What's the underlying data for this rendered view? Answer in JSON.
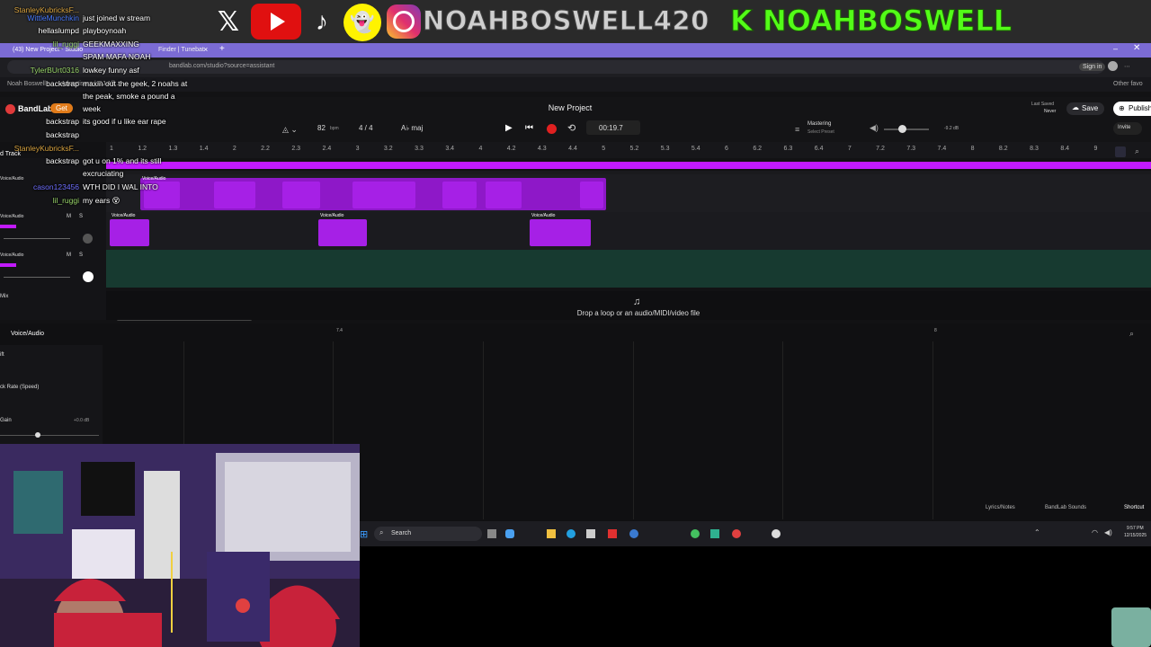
{
  "overlay": {
    "instagram_handle": "NOAHBOSWELL420",
    "kick_handle": "K NOAHBOSWELL",
    "x_icon_glyph": "𝕏",
    "tiktok_icon_glyph": "♪",
    "snapchat_icon_glyph": "👻",
    "youtube_color": "#e01010",
    "kick_color": "#53fc18"
  },
  "chat": [
    {
      "user": "StanleyKubricksF...",
      "message": "",
      "color": "#d9a441"
    },
    {
      "user": "WittleMunchkin",
      "message": "just joined w stream",
      "color": "#4a7cff"
    },
    {
      "user": "hellaslumpd",
      "message": "playboynoah",
      "color": "#ffffff"
    },
    {
      "user": "lil_ruggi",
      "message": "GEEKMAXXING",
      "color": "#9ad66b"
    },
    {
      "user": "",
      "message": "SPAM MAFA NOAH",
      "color": "#ffffff"
    },
    {
      "user": "TylerBUrt0316",
      "message": "lowkey funny asf",
      "color": "#9ad66b"
    },
    {
      "user": "backstrap",
      "message": "maxin out the geek, 2 noahs at",
      "color": "#ffffff"
    },
    {
      "user": "",
      "message": "the peak, smoke a pound a",
      "color": "#ffffff"
    },
    {
      "user": "",
      "message": "week",
      "color": "#ffffff"
    },
    {
      "user": "backstrap",
      "message": "its good if u like ear rape",
      "color": "#ffffff"
    },
    {
      "user": "backstrap",
      "message": "",
      "color": "#ffffff"
    },
    {
      "user": "StanleyKubricksF...",
      "message": "",
      "color": "#d9a441"
    },
    {
      "user": "backstrap",
      "message": "got u on 1% and its still",
      "color": "#ffffff"
    },
    {
      "user": "",
      "message": "excruciating",
      "color": "#ffffff"
    },
    {
      "user": "cason123456",
      "message": "WTH DID I WAL INTO",
      "color": "#6f6fff"
    },
    {
      "user": "lil_ruggi",
      "message": "my ears 😵",
      "color": "#9ad66b"
    }
  ],
  "browser": {
    "tab_label": "(43) New Project - Studio",
    "tab_label2": "Finder | Tunebat",
    "address": "bandlab.com/studio?source=assistant",
    "bookmark1": "Noah Boswell",
    "bookmark2": "Advertisers | CJ Aff...",
    "other_favorites": "Other favo"
  },
  "daw": {
    "brand": "BandLab",
    "get_label": "Get",
    "project_title": "New Project",
    "bpm": "82",
    "bpm_unit": "bpm",
    "time_signature": "4 / 4",
    "key": "A♭ maj",
    "time": "00:19.7",
    "mastering_label": "Mastering",
    "mastering_preset": "Select Preset",
    "volume_db": "-9.2 dB",
    "last_saved_label": "Last Saved",
    "last_saved_value": "Never",
    "save_label": "Save",
    "publish_label": "Publish",
    "invite_label": "Invite",
    "add_track_label": "d Track",
    "ruler_ticks": [
      "1",
      "1.2",
      "1.3",
      "1.4",
      "2",
      "2.2",
      "2.3",
      "2.4",
      "3",
      "3.2",
      "3.3",
      "3.4",
      "4",
      "4.2",
      "4.3",
      "4.4",
      "5",
      "5.2",
      "5.3",
      "5.4",
      "6",
      "6.2",
      "6.3",
      "6.4",
      "7",
      "7.2",
      "7.3",
      "7.4",
      "8",
      "8.2",
      "8.3",
      "8.4",
      "9"
    ],
    "tracks": [
      {
        "name": "Voice/Audio",
        "m": "M",
        "s": "S"
      },
      {
        "name": "Voice/Audio",
        "m": "M",
        "s": "S"
      },
      {
        "name": "Voice/Audio",
        "m": "M",
        "s": "S"
      }
    ],
    "clip_label": "Voice/Audio",
    "drop_hint": "Drop a loop or an audio/MIDI/video file",
    "mix_label": "Mix",
    "lower_track_name": "Voice/Audio",
    "lower_ruler_a": "7.4",
    "lower_ruler_b": "8",
    "pitch_label": "ift",
    "rate_label": "ck Rate (Speed)",
    "gain_label": "Gain",
    "gain_value": "+0.0 dB",
    "lyrics_label": "Lyrics/Notes",
    "sounds_label": "BandLab Sounds",
    "shortcuts_label": "Shortcut"
  },
  "taskbar": {
    "search_label": "Search",
    "clock_time": "9:57 PM",
    "clock_date": "12/15/2025"
  },
  "accent_color": "#c21aff"
}
